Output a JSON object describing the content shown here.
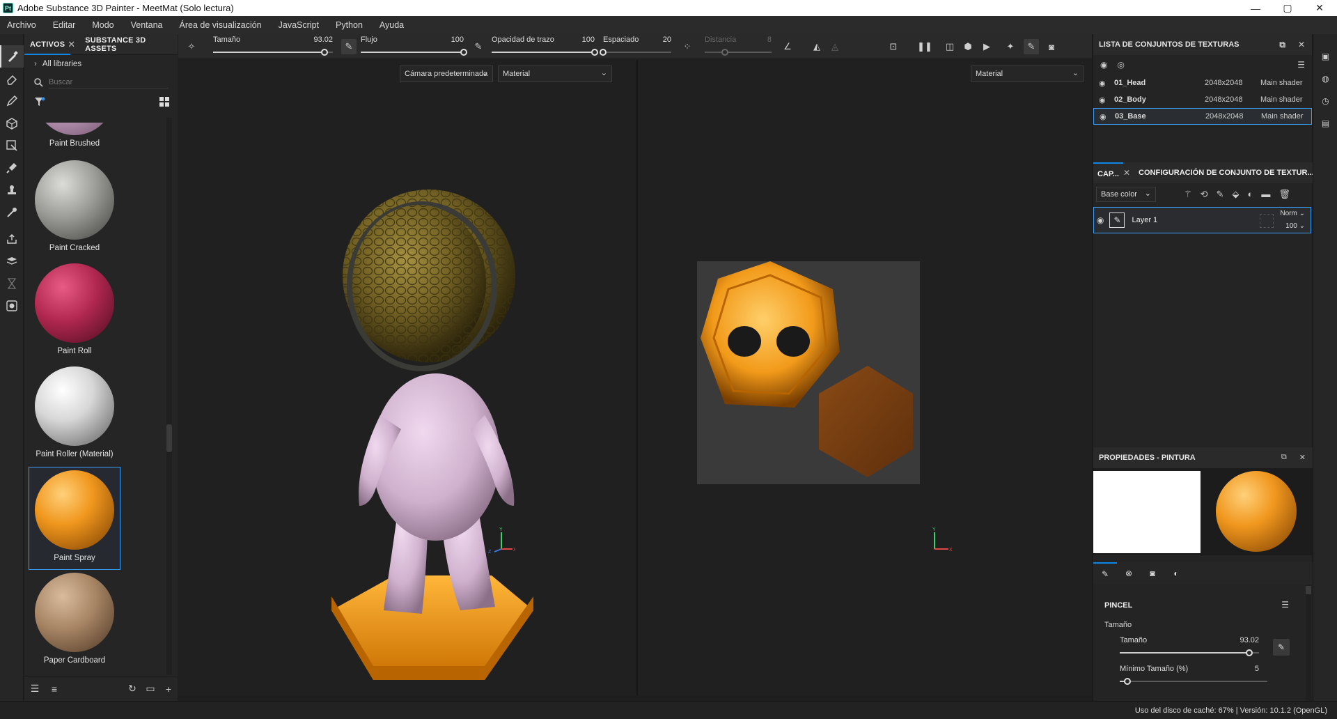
{
  "window": {
    "title": "Adobe Substance 3D Painter - MeetMat (Solo lectura)",
    "app_icon_text": "Pt",
    "minimize": "—",
    "maximize": "▢",
    "close": "✕"
  },
  "menu": [
    "Archivo",
    "Editar",
    "Modo",
    "Ventana",
    "Área de visualización",
    "JavaScript",
    "Python",
    "Ayuda"
  ],
  "assets_panel": {
    "tab_activos": "ACTIVOS",
    "tab_assets": "SUBSTANCE 3D ASSETS",
    "library": "All libraries",
    "search_placeholder": "Buscar",
    "items": [
      {
        "label": "Paint Brushed",
        "color": "#c9a3c4"
      },
      {
        "label": "Paint Cracked",
        "color": "#9a9a96"
      },
      {
        "label": "Paint Roll",
        "color": "#b0274f"
      },
      {
        "label": "Paint Roller (Material)",
        "color": "#d7d7d7"
      },
      {
        "label": "Paint Spray",
        "color": "#f0971e"
      },
      {
        "label": "Paper Cardboard",
        "color": "#a58363"
      }
    ]
  },
  "options_bar": {
    "size_label": "Tamaño",
    "size_value": "93.02",
    "size_fraction": 0.93,
    "flow_label": "Flujo",
    "flow_value": "100",
    "flow_fraction": 1.0,
    "opacity_label": "Opacidad de trazo",
    "opacity_value": "100",
    "opacity_fraction": 1.0,
    "spacing_label": "Espaciado",
    "spacing_value": "20",
    "spacing_fraction": 0.0,
    "distance_label": "Distancia",
    "distance_value": "8",
    "distance_fraction": 0.3
  },
  "viewport": {
    "camera": "Cámara predeterminada",
    "mode_3d": "Material",
    "mode_2d": "Material",
    "axis_y": "Y",
    "axis_x": "X",
    "axis_z": "Z"
  },
  "texture_sets": {
    "title": "LISTA DE CONJUNTOS DE TEXTURAS",
    "rows": [
      {
        "name": "01_Head",
        "resolution": "2048x2048",
        "shader": "Main shader"
      },
      {
        "name": "02_Body",
        "resolution": "2048x2048",
        "shader": "Main shader"
      },
      {
        "name": "03_Base",
        "resolution": "2048x2048",
        "shader": "Main shader"
      }
    ]
  },
  "layers": {
    "tab_layers": "CAP...",
    "tab_config": "CONFIGURACIÓN DE CONJUNTO DE TEXTUR...",
    "channel": "Base color",
    "layer_name": "Layer 1",
    "blend_mode": "Norm",
    "opacity": "100"
  },
  "properties": {
    "title": "PROPIEDADES - PINTURA",
    "section": "PINCEL",
    "group": "Tamaño",
    "size_label": "Tamaño",
    "size_value": "93.02",
    "size_fraction": 0.93,
    "min_size_label": "Mínimo Tamaño (%)",
    "min_size_value": "5",
    "min_size_fraction": 0.05
  },
  "status": {
    "text": "Uso del disco de caché:  67% | Versión: 10.1.2 (OpenGL)"
  },
  "colors": {
    "accent": "#0d86e6",
    "selection": "#3aa0ff",
    "orange": "#f0971e"
  }
}
